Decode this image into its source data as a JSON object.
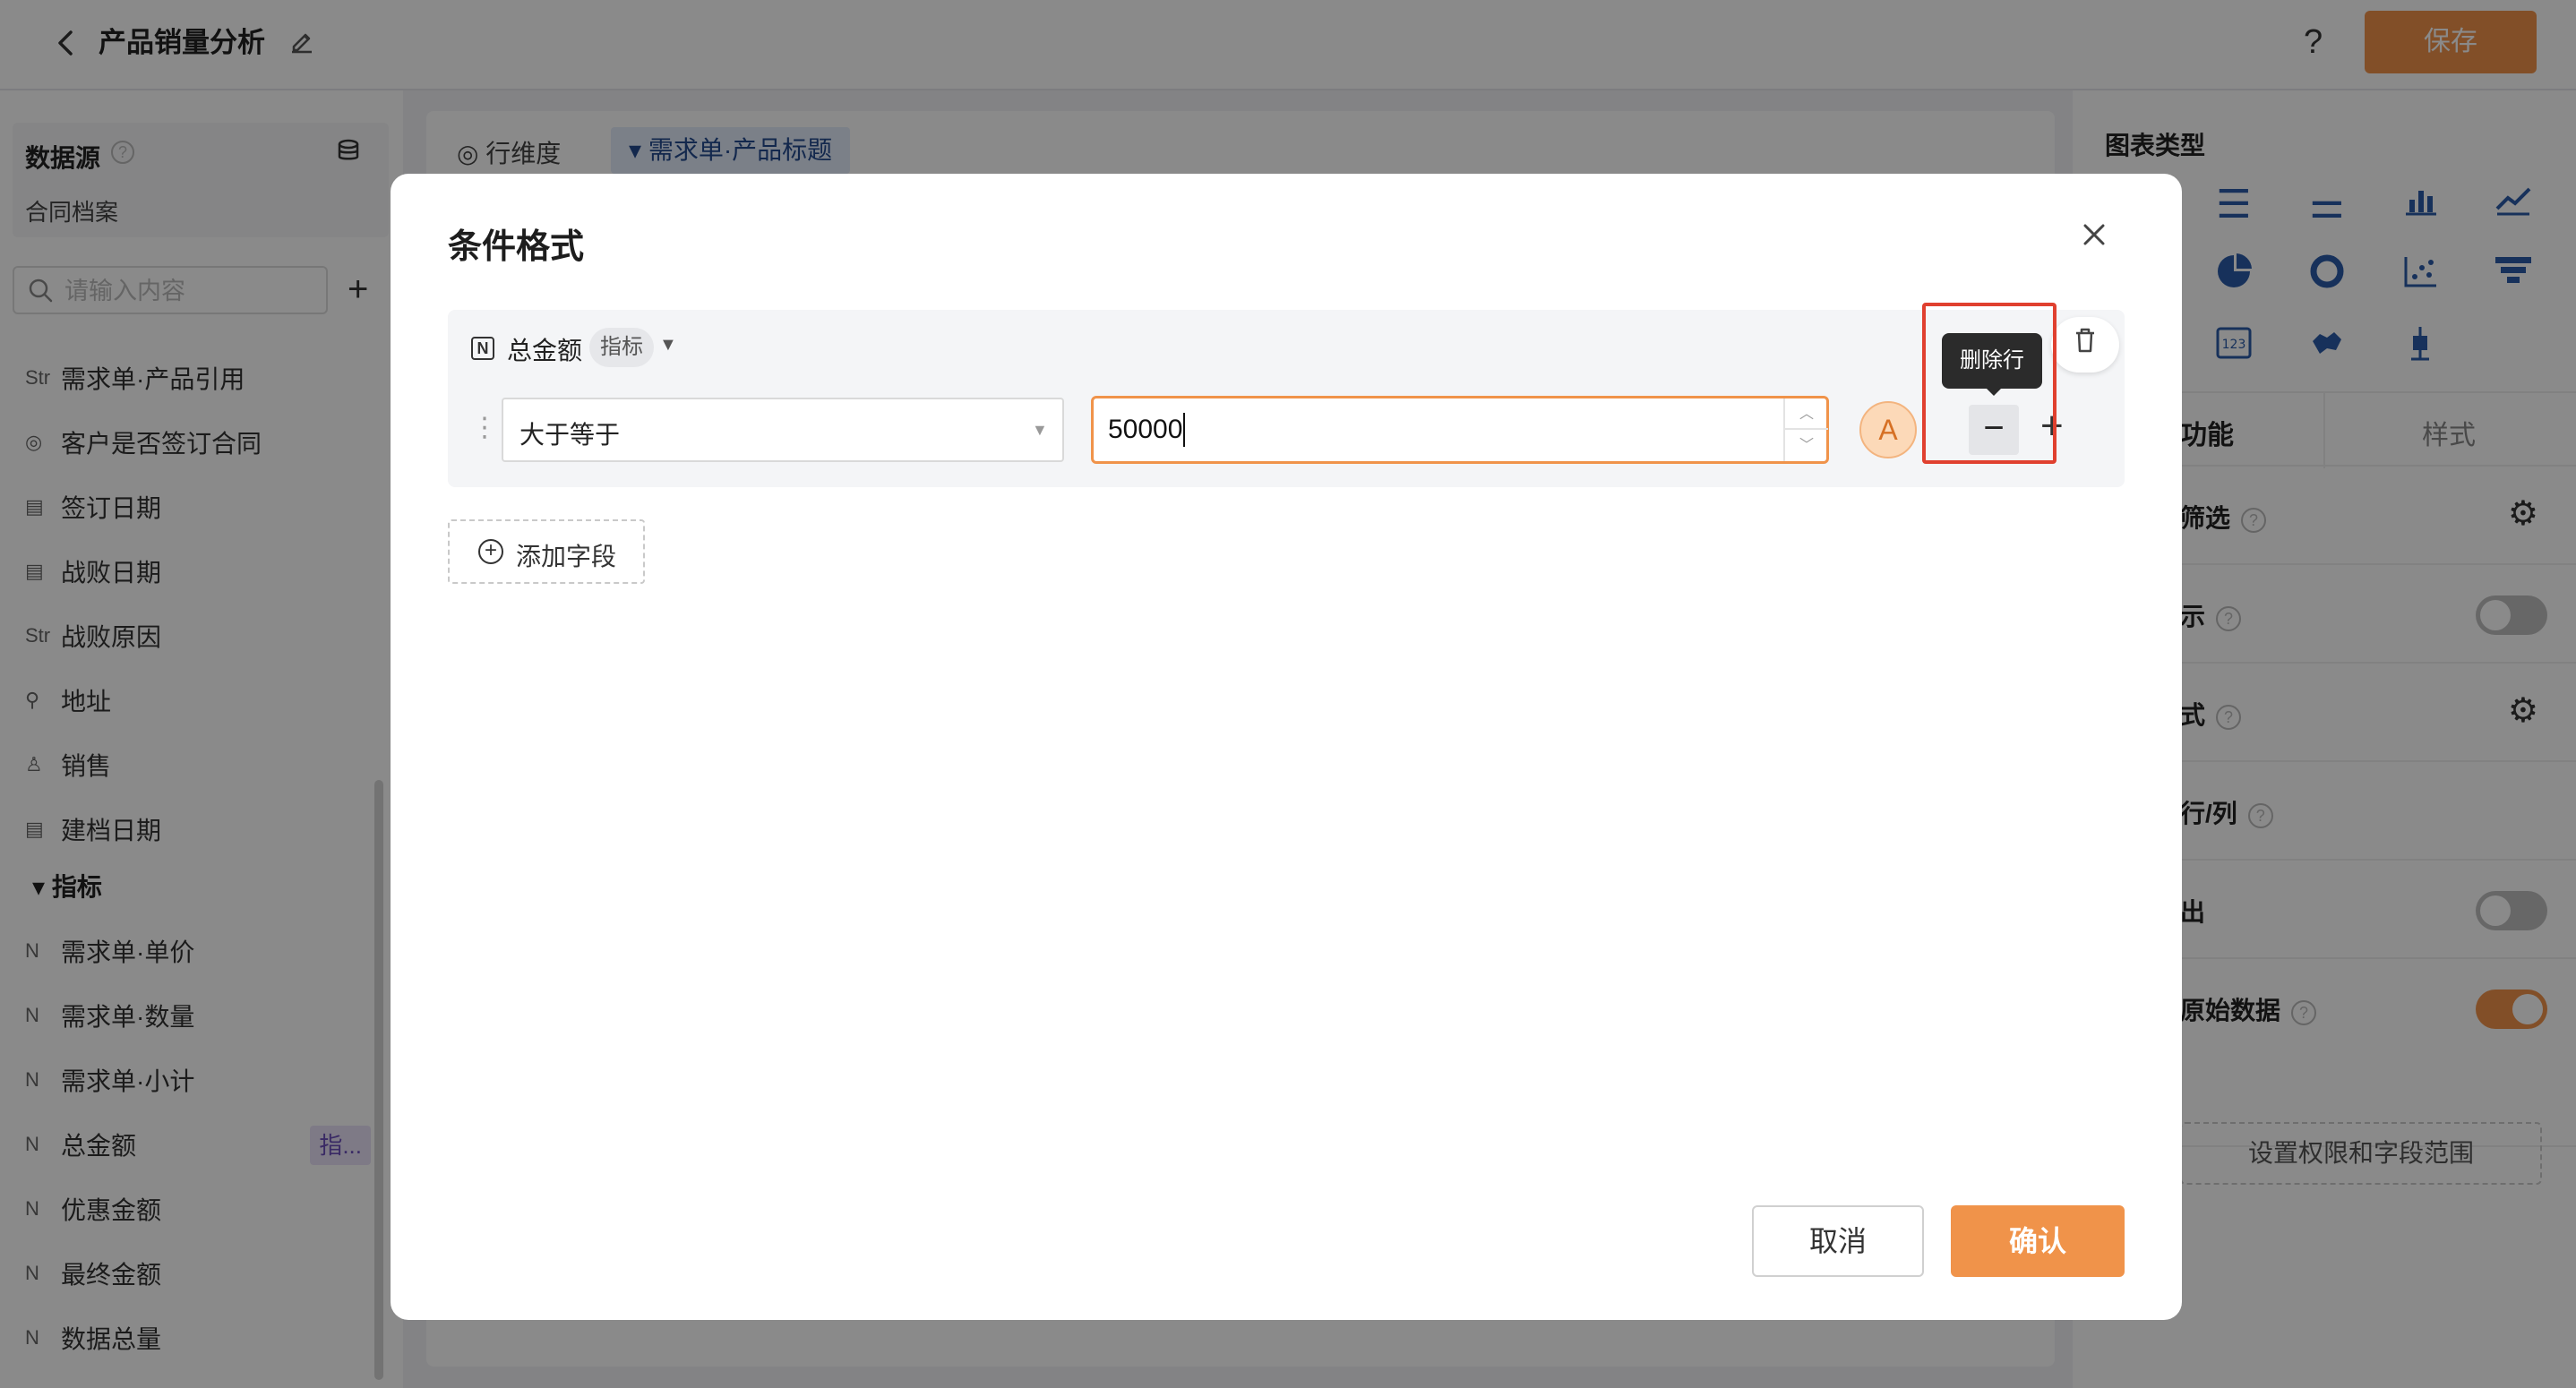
{
  "header": {
    "back_icon": "chevron-left-icon",
    "title": "产品销量分析",
    "edit_icon": "pencil-icon",
    "help_label": "?",
    "save_label": "保存",
    "accent_color": "#f0934a"
  },
  "sidebar": {
    "datasource_title": "数据源",
    "datasource_name": "合同档案",
    "search_placeholder": "请输入内容",
    "add_label": "+",
    "dimension_fields": [
      {
        "prefix": "Str",
        "label": "需求单·产品引用"
      },
      {
        "prefix": "◎",
        "label": "客户是否签订合同"
      },
      {
        "prefix": "▤",
        "label": "签订日期"
      },
      {
        "prefix": "▤",
        "label": "战败日期"
      },
      {
        "prefix": "Str",
        "label": "战败原因"
      },
      {
        "prefix": "⚲",
        "label": "地址"
      },
      {
        "prefix": "♙",
        "label": "销售"
      },
      {
        "prefix": "▤",
        "label": "建档日期"
      }
    ],
    "metrics_group": "▾ 指标",
    "metric_fields": [
      {
        "prefix": "N",
        "label": "需求单·单价"
      },
      {
        "prefix": "N",
        "label": "需求单·数量"
      },
      {
        "prefix": "N",
        "label": "需求单·小计"
      },
      {
        "prefix": "N",
        "label": "总金额",
        "tag": "指..."
      },
      {
        "prefix": "N",
        "label": "优惠金额"
      },
      {
        "prefix": "N",
        "label": "最终金额"
      },
      {
        "prefix": "N",
        "label": "数据总量"
      }
    ]
  },
  "middle": {
    "row_dim_label": "行维度",
    "row_dim_chip": "▾ 需求单·产品标题"
  },
  "right": {
    "chart_type_title": "图表类型",
    "tab_function": "功能",
    "tab_style": "样式",
    "options": [
      {
        "label": "筛选",
        "control": "gear"
      },
      {
        "label": "示",
        "control": "toggle-off"
      },
      {
        "label": "式",
        "control": "gear"
      },
      {
        "label": "行/列",
        "control": "none"
      },
      {
        "label": "出",
        "control": "toggle-off"
      },
      {
        "label": "原始数据",
        "control": "toggle-on"
      }
    ],
    "permission_button": "设置权限和字段范围"
  },
  "dialog": {
    "title": "条件格式",
    "close_label": "✕",
    "field_name": "总金额",
    "field_badge": "指标",
    "operator": "大于等于",
    "value": "50000",
    "style_label": "A",
    "delete_row_label": "−",
    "add_row_label": "+",
    "tooltip": "删除行",
    "add_field_label": "添加字段",
    "cancel_label": "取消",
    "confirm_label": "确认"
  }
}
